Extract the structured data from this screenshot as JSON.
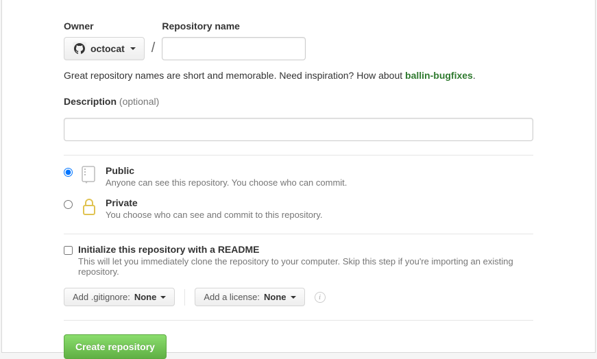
{
  "labels": {
    "owner": "Owner",
    "repo_name": "Repository name",
    "description": "Description",
    "optional": "(optional)"
  },
  "owner": {
    "username": "octocat"
  },
  "hint": {
    "text_before": "Great repository names are short and memorable. Need inspiration? How about ",
    "suggestion": "ballin-bugfixes",
    "text_after": "."
  },
  "visibility": {
    "public": {
      "title": "Public",
      "sub": "Anyone can see this repository. You choose who can commit."
    },
    "private": {
      "title": "Private",
      "sub": "You choose who can see and commit to this repository."
    }
  },
  "readme": {
    "title": "Initialize this repository with a README",
    "sub": "This will let you immediately clone the repository to your computer. Skip this step if you're importing an existing repository."
  },
  "dropdowns": {
    "gitignore_label": "Add .gitignore:",
    "gitignore_value": "None",
    "license_label": "Add a license:",
    "license_value": "None"
  },
  "submit": "Create repository"
}
